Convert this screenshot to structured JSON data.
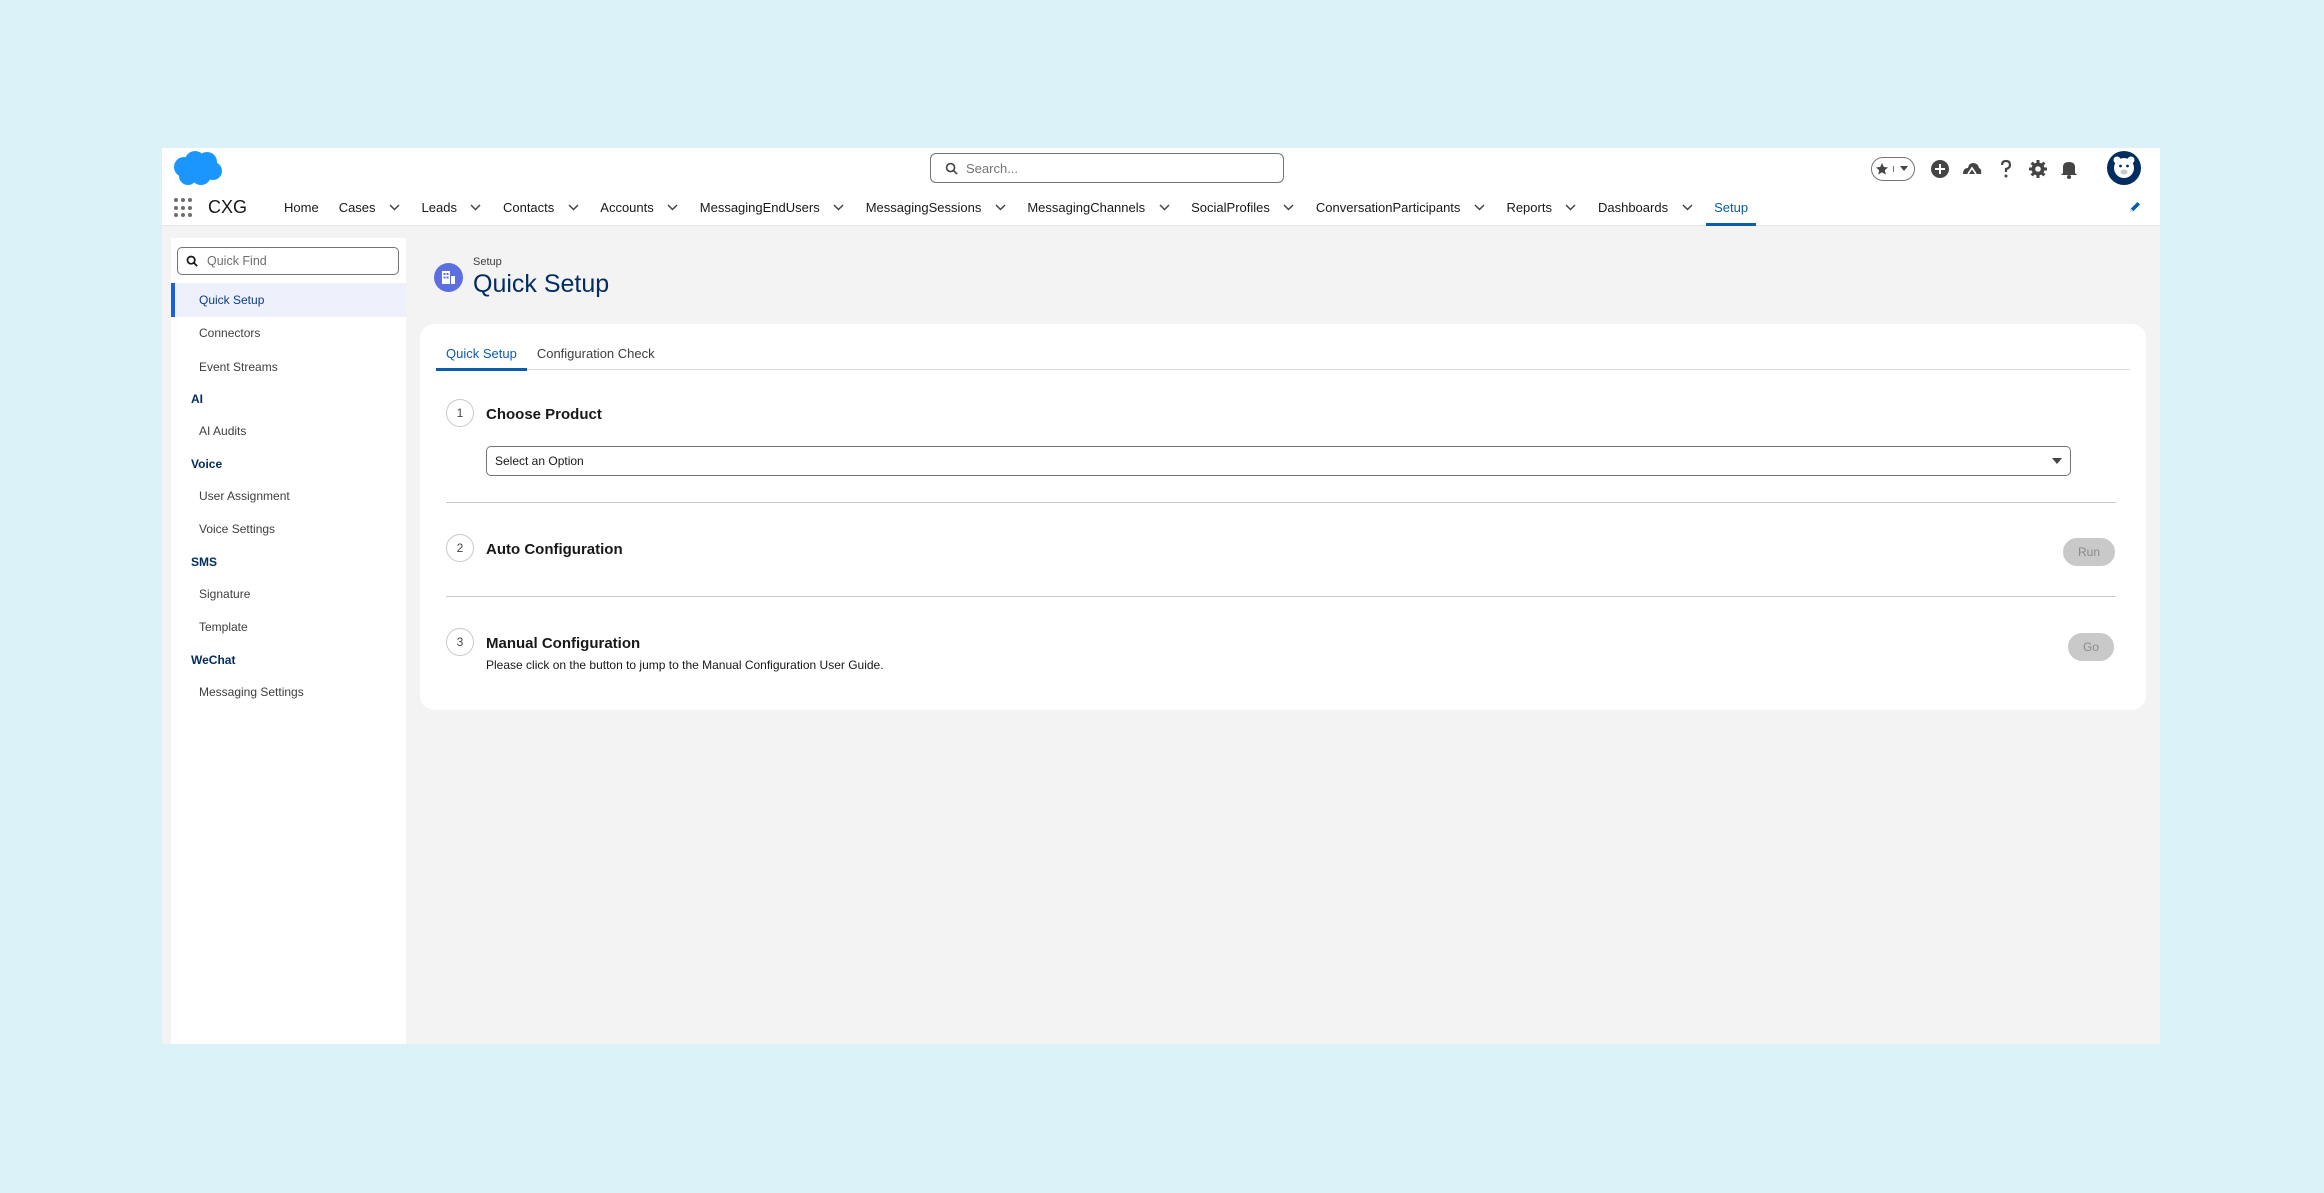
{
  "header": {
    "search_placeholder": "Search...",
    "app_name": "CXG",
    "icons": [
      "favorites-star-icon",
      "favorites-dropdown-icon",
      "global-add-icon",
      "trailhead-icon",
      "help-icon",
      "setup-gear-icon",
      "notifications-bell-icon",
      "user-avatar"
    ]
  },
  "nav": {
    "items": [
      {
        "label": "Home",
        "dropdown": false
      },
      {
        "label": "Cases",
        "dropdown": true
      },
      {
        "label": "Leads",
        "dropdown": true
      },
      {
        "label": "Contacts",
        "dropdown": true
      },
      {
        "label": "Accounts",
        "dropdown": true
      },
      {
        "label": "MessagingEndUsers",
        "dropdown": true
      },
      {
        "label": "MessagingSessions",
        "dropdown": true
      },
      {
        "label": "MessagingChannels",
        "dropdown": true
      },
      {
        "label": "SocialProfiles",
        "dropdown": true
      },
      {
        "label": "ConversationParticipants",
        "dropdown": true
      },
      {
        "label": "Reports",
        "dropdown": true
      },
      {
        "label": "Dashboards",
        "dropdown": true
      },
      {
        "label": "Setup",
        "dropdown": false,
        "active": true
      }
    ]
  },
  "sidebar": {
    "quick_find_placeholder": "Quick Find",
    "entries": [
      {
        "type": "item",
        "label": "Quick Setup",
        "active": true
      },
      {
        "type": "item",
        "label": "Connectors"
      },
      {
        "type": "item",
        "label": "Event Streams"
      },
      {
        "type": "heading",
        "label": "AI"
      },
      {
        "type": "item",
        "label": "AI Audits"
      },
      {
        "type": "heading",
        "label": "Voice"
      },
      {
        "type": "item",
        "label": "User Assignment"
      },
      {
        "type": "item",
        "label": "Voice Settings"
      },
      {
        "type": "heading",
        "label": "SMS"
      },
      {
        "type": "item",
        "label": "Signature"
      },
      {
        "type": "item",
        "label": "Template"
      },
      {
        "type": "heading",
        "label": "WeChat"
      },
      {
        "type": "item",
        "label": "Messaging Settings"
      }
    ]
  },
  "page": {
    "breadcrumb": "Setup",
    "title": "Quick Setup"
  },
  "tabs": [
    {
      "label": "Quick Setup",
      "active": true
    },
    {
      "label": "Configuration Check",
      "active": false
    }
  ],
  "steps": {
    "step1": {
      "number": "1",
      "title": "Choose Product",
      "select_value": "Select an Option"
    },
    "step2": {
      "number": "2",
      "title": "Auto Configuration",
      "button": "Run"
    },
    "step3": {
      "number": "3",
      "title": "Manual Configuration",
      "description": "Please click on the button to jump to the Manual Configuration User Guide.",
      "button": "Go"
    }
  },
  "colors": {
    "brand_blue": "#0b5cab",
    "navy": "#032d60",
    "page_background": "#dbf2f8",
    "logo_blue": "#1b96ff"
  }
}
